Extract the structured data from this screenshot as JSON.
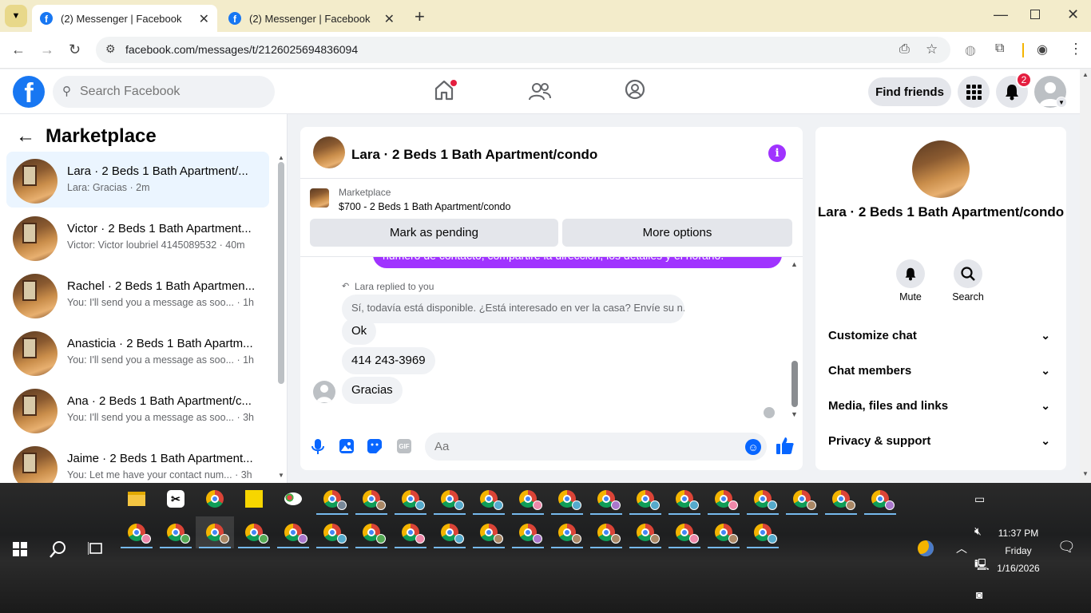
{
  "browser": {
    "tabs": [
      {
        "title": "(2) Messenger | Facebook",
        "active": true
      },
      {
        "title": "(2) Messenger | Facebook",
        "active": false
      }
    ],
    "url": "facebook.com/messages/t/2126025694836094"
  },
  "fb_header": {
    "search_placeholder": "Search Facebook",
    "find_friends": "Find friends",
    "notification_count": "2"
  },
  "left_pane": {
    "title": "Marketplace",
    "conversations": [
      {
        "name": "Lara · 2 Beds 1 Bath Apartment/...",
        "preview": "Lara: Gracias · 2m",
        "active": true
      },
      {
        "name": "Victor · 2 Beds 1 Bath Apartment...",
        "preview": "Victor: Victor loubriel 4145089532 · 40m",
        "active": false
      },
      {
        "name": "Rachel · 2 Beds 1 Bath Apartmen...",
        "preview": "You: I'll send you a message as soo... · 1h",
        "active": false
      },
      {
        "name": "Anasticia · 2 Beds 1 Bath Apartm...",
        "preview": "You: I'll send you a message as soo... · 1h",
        "active": false
      },
      {
        "name": "Ana · 2 Beds 1 Bath Apartment/c...",
        "preview": "You: I'll send you a message as soo... · 3h",
        "active": false
      },
      {
        "name": "Jaime · 2 Beds 1 Bath Apartment...",
        "preview": "You: Let me have your contact num... · 3h",
        "active": false
      }
    ]
  },
  "chat": {
    "title": "Lara · 2 Beds 1 Bath Apartment/condo",
    "marketplace_label": "Marketplace",
    "listing": "$700 - 2 Beds 1 Bath Apartment/condo",
    "mark_pending": "Mark as pending",
    "more_options": "More options",
    "outgoing_partial": "número de contacto, compartiré la dirección, los detalles y el horario.",
    "replied_label": "Lara replied to you",
    "quoted_message": "Sí, todavía está disponible. ¿Está interesado en ver la casa? Envíe su n...",
    "messages": [
      "Ok",
      "414 243-3969",
      "Gracias"
    ],
    "composer_placeholder": "Aa"
  },
  "right_pane": {
    "name": "Lara · 2 Beds 1 Bath Apartment/condo",
    "mute": "Mute",
    "search": "Search",
    "sections": [
      "Customize chat",
      "Chat members",
      "Media, files and links",
      "Privacy & support"
    ]
  },
  "taskbar": {
    "time": "11:37 PM",
    "day": "Friday",
    "date": "1/16/2026"
  }
}
